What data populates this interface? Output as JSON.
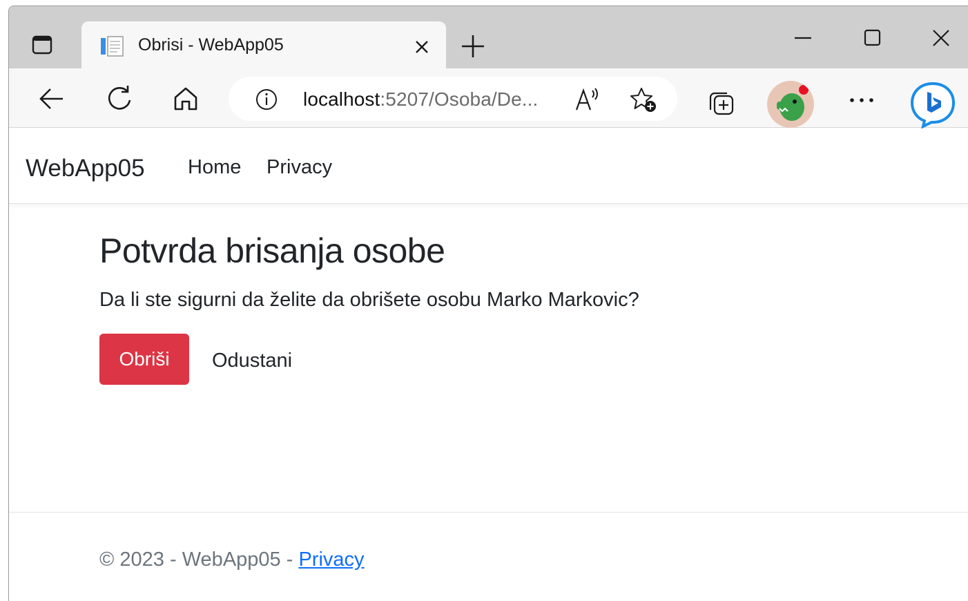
{
  "browser": {
    "tab": {
      "title": "Obrisi - WebApp05"
    },
    "address": {
      "host": "localhost",
      "path": ":5207/Osoba/De..."
    },
    "icons": {
      "tab_actions": "tab-actions-icon",
      "close": "close-icon",
      "new_tab": "plus-icon",
      "back": "back-arrow-icon",
      "refresh": "refresh-icon",
      "home": "home-icon",
      "info": "info-icon",
      "read_aloud": "read-aloud-icon",
      "favorites": "add-favorite-icon",
      "collections": "collections-icon",
      "more": "more-icon",
      "copilot": "bing-copilot-icon"
    }
  },
  "site": {
    "brand": "WebApp05",
    "nav": {
      "home": "Home",
      "privacy": "Privacy"
    }
  },
  "main": {
    "title": "Potvrda brisanja osobe",
    "question": "Da li ste sigurni da želite da obrišete osobu Marko Markovic?",
    "delete_label": "Obriši",
    "cancel_label": "Odustani"
  },
  "footer": {
    "text": "© 2023 - WebApp05 - ",
    "link": "Privacy"
  },
  "colors": {
    "danger": "#dc3545",
    "link": "#0d6efd",
    "muted": "#6c757d"
  }
}
